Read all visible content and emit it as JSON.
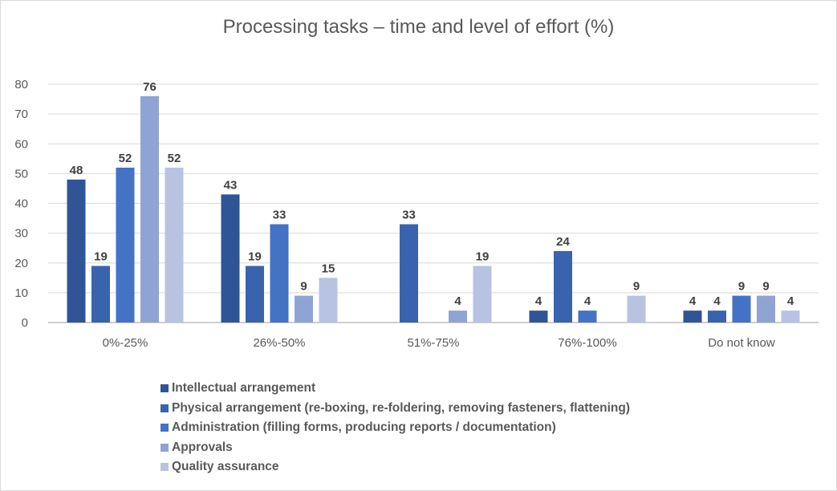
{
  "chart_data": {
    "type": "bar",
    "title": "Processing tasks – time and level of effort (%)",
    "xlabel": "",
    "ylabel": "",
    "ylim": [
      0,
      80
    ],
    "yticks": [
      0,
      10,
      20,
      30,
      40,
      50,
      60,
      70,
      80
    ],
    "grid": true,
    "legend_position": "bottom",
    "categories": [
      "0%-25%",
      "26%-50%",
      "51%-75%",
      "76%-100%",
      "Do not know"
    ],
    "series": [
      {
        "name": "Intellectual arrangement",
        "color": "#2f5597",
        "values": [
          48,
          43,
          null,
          4,
          4
        ]
      },
      {
        "name": "Physical arrangement (re-boxing, re-foldering, removing fasteners, flattening)",
        "color": "#3a63ad",
        "values": [
          19,
          19,
          33,
          24,
          4
        ]
      },
      {
        "name": "Administration (filling forms, producing reports / documentation)",
        "color": "#4472c4",
        "values": [
          52,
          33,
          null,
          4,
          9
        ]
      },
      {
        "name": "Approvals",
        "color": "#8fa4d4",
        "values": [
          76,
          9,
          4,
          null,
          9
        ]
      },
      {
        "name": "Quality assurance",
        "color": "#b8c3e2",
        "values": [
          52,
          15,
          19,
          9,
          4
        ]
      }
    ]
  }
}
